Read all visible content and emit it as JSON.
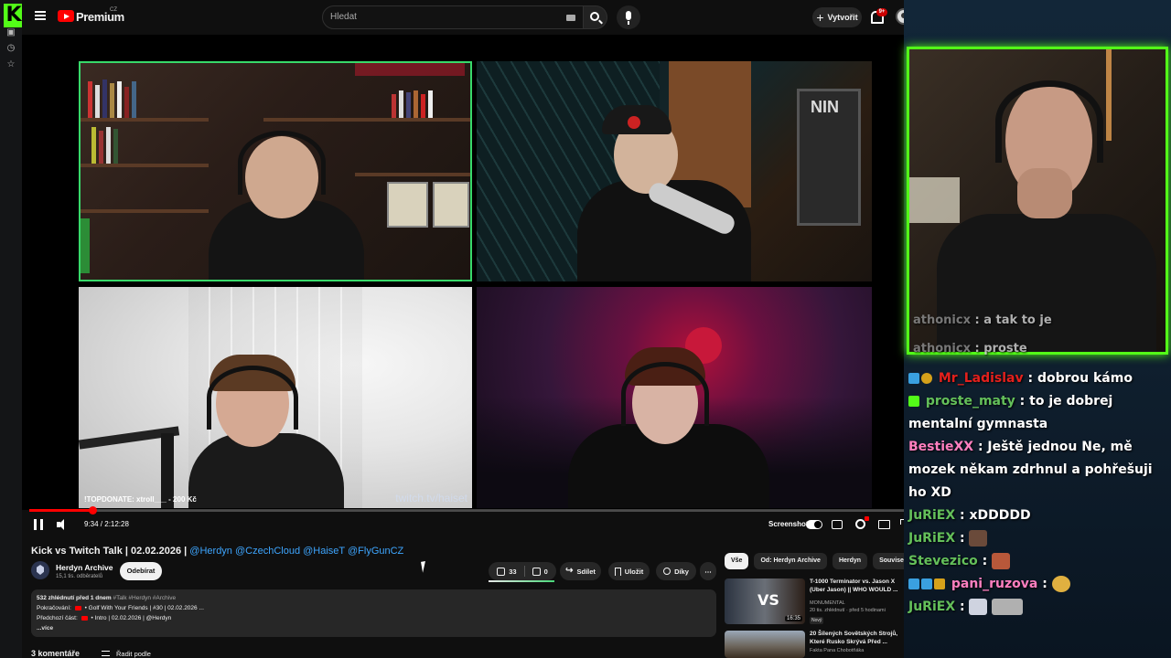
{
  "youtube": {
    "brand": "Premium",
    "country_code": "CZ",
    "search": {
      "placeholder": "Hledat"
    },
    "create_label": "Vytvořit",
    "notif_count": "9+",
    "player": {
      "time": "9:34 / 2:12:28",
      "progress_fraction": 0.072,
      "screenshot_label": "Screenshot",
      "tiles": {
        "tile3_caption": "!TOPDONATE: xtroll___ - 200 Kč",
        "tile3_watermark": "twitch.tv/haiset"
      }
    },
    "video": {
      "title": "Kick vs Twitch Talk | 02.02.2026 |",
      "title_tags": "@Herdyn @CzechCloud @HaiseT @FlyGunCZ"
    },
    "channel": {
      "name": "Herdyn Archive",
      "subs": "15,1 tis. odběratelů",
      "subscribe_label": "Odebírat"
    },
    "actions": {
      "likes": "33",
      "dislikes": "0",
      "share": "Sdílet",
      "save": "Uložit",
      "thanks": "Díky"
    },
    "description": {
      "views_date": "532 zhlédnutí  před 1 dnem",
      "hashtags": "#Talk #Herdyn #Archive",
      "line2_label": "Pokračování:",
      "line2_text": "• Golf With Your Friends | #30 | 02.02.2026 ...",
      "line3_label": "Předchozí část:",
      "line3_text": "• Intro | 02.02.2026 | @Herdyn",
      "more": "...více"
    },
    "comments": {
      "count_label": "3 komentáře",
      "sort_label": "Řadit podle"
    },
    "chips": [
      "Vše",
      "Od: Herdyn Archive",
      "Herdyn",
      "Souvise"
    ],
    "recommendations": [
      {
        "title": "T-1000 Terminator vs. Jason X (Uber Jason) || WHO WOULD ...",
        "channel": "MONUMENTAL",
        "meta": "20 tis. zhlédnutí · před 5 hodinami",
        "badge": "Nový",
        "duration": "16:35",
        "thumb_text": "VS"
      },
      {
        "title": "20 Šílených Sovětských Strojů, Které Rusko Skrývá Před ...",
        "channel": "Fakta Pana Chobotňáka"
      }
    ]
  },
  "kick": {
    "overlay_chat": [
      {
        "user": "athonicx",
        "text": ": a tak to je"
      },
      {
        "user": "athonicx",
        "text": ": proste"
      }
    ],
    "chat": [
      {
        "user": "Mr_Ladislav",
        "text": ": dobrou kámo"
      },
      {
        "user": "proste_maty",
        "text": ": to je dobrej mentalní gymnasta"
      },
      {
        "user": "BestieXX",
        "text": ": Ještě jednou Ne, mě mozek někam zdrhnul a pohřešuji ho XD"
      },
      {
        "user": "JuRiEX",
        "text": ": xDDDDD"
      },
      {
        "user": "JuRiEX",
        "text": ":"
      },
      {
        "user": "Stevezico",
        "text": ":"
      },
      {
        "user": "pani_ruzova",
        "text": ":"
      },
      {
        "user": "JuRiEX",
        "text": ":"
      }
    ]
  },
  "colors": {
    "kick_green": "#53fc18",
    "yt_red": "#ff0000",
    "link_blue": "#3ea6ff"
  }
}
